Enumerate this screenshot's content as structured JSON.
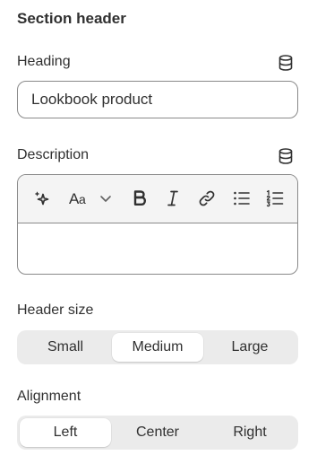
{
  "section_title": "Section header",
  "heading": {
    "label": "Heading",
    "value": "Lookbook product",
    "dynamic_source_icon": "database-icon"
  },
  "description": {
    "label": "Description",
    "dynamic_source_icon": "database-icon",
    "value": "",
    "toolbar": [
      {
        "name": "ai-generate-icon"
      },
      {
        "name": "text-style-icon"
      },
      {
        "name": "chevron-down-icon"
      },
      {
        "name": "bold-icon"
      },
      {
        "name": "italic-icon"
      },
      {
        "name": "link-icon"
      },
      {
        "name": "bullet-list-icon"
      },
      {
        "name": "numbered-list-icon"
      }
    ]
  },
  "header_size": {
    "label": "Header size",
    "options": [
      "Small",
      "Medium",
      "Large"
    ],
    "selected": "Medium"
  },
  "alignment": {
    "label": "Alignment",
    "options": [
      "Left",
      "Center",
      "Right"
    ],
    "selected": "Left"
  },
  "colors": {
    "text": "#303030",
    "border": "#8a8a8a",
    "segment_bg": "#ebebeb",
    "toolbar_bg": "#f4f4f4"
  }
}
